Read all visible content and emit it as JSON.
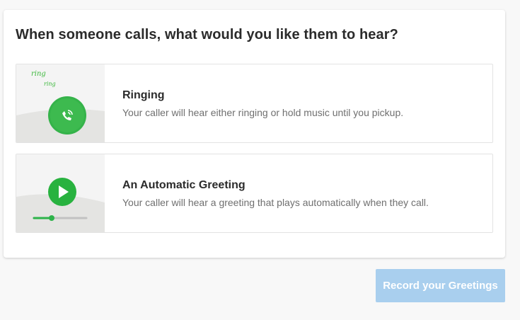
{
  "question": "When someone calls, what would you like them to hear?",
  "options": [
    {
      "title": "Ringing",
      "description": "Your caller will hear either ringing or hold music until you pickup.",
      "thumb_words": [
        "ring",
        "ring"
      ],
      "icon": "phone-ringing-icon"
    },
    {
      "title": "An Automatic Greeting",
      "description": "Your caller will hear a greeting that plays automatically when they call.",
      "icon": "play-icon",
      "audio_progress": 0.33
    }
  ],
  "record_button": "Record your Greetings",
  "colors": {
    "accent_green": "#2db34a",
    "button_disabled_blue": "#a9cfee",
    "text_dark": "#2b2b2b",
    "text_muted": "#6f6f6f"
  }
}
